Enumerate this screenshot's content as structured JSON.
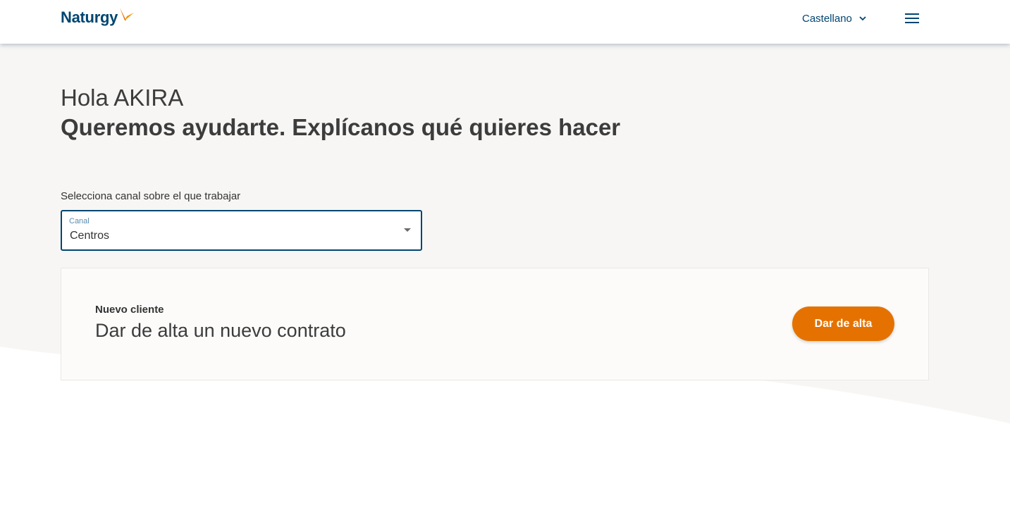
{
  "header": {
    "logo_text": "Naturgy",
    "language": "Castellano",
    "menu_icon": "hamburger-menu-icon",
    "brand_color": "#004571",
    "accent_color": "#e57200"
  },
  "main": {
    "greeting": "Hola AKIRA",
    "headline": "Queremos ayudarte. Explícanos qué quieres hacer",
    "channel_select": {
      "label": "Selecciona canal sobre el que trabajar",
      "floating_label": "Canal",
      "value": "Centros"
    },
    "card": {
      "eyebrow": "Nuevo cliente",
      "title": "Dar de alta un nuevo contrato",
      "button_label": "Dar de alta"
    }
  }
}
